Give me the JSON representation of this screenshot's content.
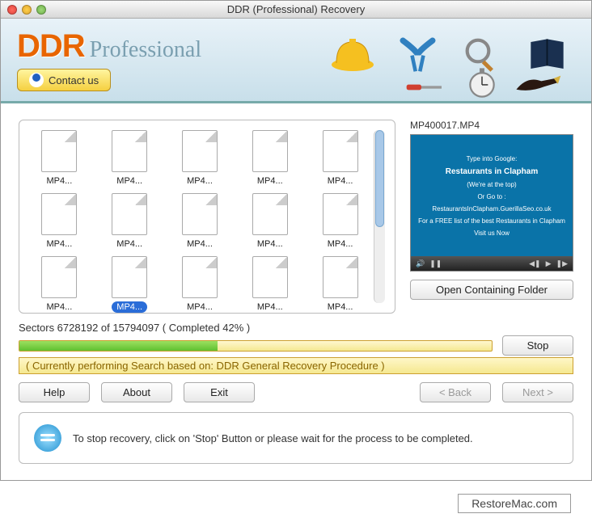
{
  "titlebar": {
    "title": "DDR (Professional) Recovery"
  },
  "brand": {
    "logo": "DDR",
    "sub": "Professional",
    "contact": "Contact us"
  },
  "files": {
    "items": [
      {
        "label": "MP4...",
        "selected": false
      },
      {
        "label": "MP4...",
        "selected": false
      },
      {
        "label": "MP4...",
        "selected": false
      },
      {
        "label": "MP4...",
        "selected": false
      },
      {
        "label": "MP4...",
        "selected": false
      },
      {
        "label": "MP4...",
        "selected": false
      },
      {
        "label": "MP4...",
        "selected": false
      },
      {
        "label": "MP4...",
        "selected": false
      },
      {
        "label": "MP4...",
        "selected": false
      },
      {
        "label": "MP4...",
        "selected": false
      },
      {
        "label": "MP4...",
        "selected": false
      },
      {
        "label": "MP4...",
        "selected": true
      },
      {
        "label": "MP4...",
        "selected": false
      },
      {
        "label": "MP4...",
        "selected": false
      },
      {
        "label": "MP4...",
        "selected": false
      }
    ]
  },
  "preview": {
    "filename": "MP400017.MP4",
    "lines": {
      "l1": "Type into Google:",
      "l2": "Restaurants in Clapham",
      "l3": "(We're at the top)",
      "l4": "Or Go to :",
      "l5": "RestaurantsInClapham.GuerillaSeo.co.uk",
      "l6": "For a FREE list of the best Restaurants in Clapham",
      "l7": "Visit us Now"
    },
    "open_folder": "Open Containing Folder"
  },
  "progress": {
    "sectors": "Sectors 6728192 of 15794097   ( Completed 42% )",
    "percent": 42,
    "note": "( Currently performing Search based on: DDR General Recovery Procedure )",
    "stop": "Stop"
  },
  "buttons": {
    "help": "Help",
    "about": "About",
    "exit": "Exit",
    "back": "< Back",
    "next": "Next >"
  },
  "hint": {
    "text": "To stop recovery, click on 'Stop' Button or please wait for the process to be completed."
  },
  "footer": {
    "text": "RestoreMac.com"
  }
}
